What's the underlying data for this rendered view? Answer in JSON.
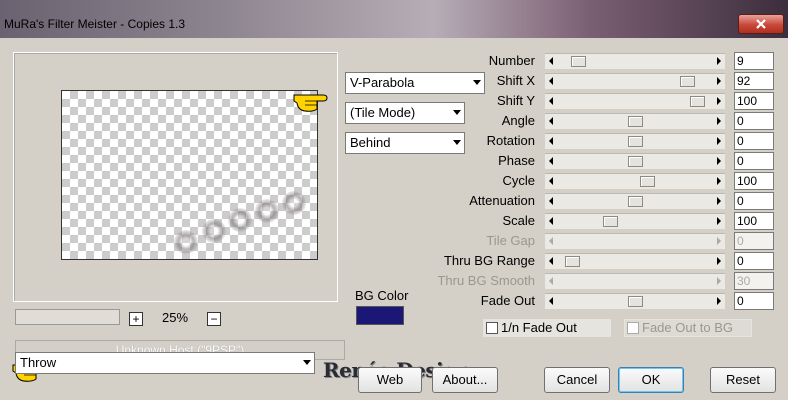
{
  "window": {
    "title": "MuRa's Filter Meister - Copies 1.3"
  },
  "preview": {
    "zoom": "25%",
    "zoom_in": "+",
    "zoom_out": "−",
    "host": "Unknown Host (\"9PSP\")"
  },
  "dropdowns": {
    "mode": "V-Parabola",
    "tile_mode": "(Tile Mode)",
    "placement": "Behind",
    "action": "Throw"
  },
  "bg_color": {
    "label": "BG Color",
    "value": "#1a1777"
  },
  "controls": [
    {
      "label": "Number",
      "value": "9",
      "level": 0.05,
      "enabled": true
    },
    {
      "label": "Shift X",
      "value": "92",
      "level": 0.92,
      "enabled": true
    },
    {
      "label": "Shift Y",
      "value": "100",
      "level": 1.0,
      "enabled": true
    },
    {
      "label": "Angle",
      "value": "0",
      "level": 0.5,
      "enabled": true
    },
    {
      "label": "Rotation",
      "value": "0",
      "level": 0.5,
      "enabled": true
    },
    {
      "label": "Phase",
      "value": "0",
      "level": 0.5,
      "enabled": true
    },
    {
      "label": "Cycle",
      "value": "100",
      "level": 0.6,
      "enabled": true
    },
    {
      "label": "Attenuation",
      "value": "0",
      "level": 0.5,
      "enabled": true
    },
    {
      "label": "Scale",
      "value": "100",
      "level": 0.3,
      "enabled": true
    },
    {
      "label": "Tile Gap",
      "value": "0",
      "level": 0.0,
      "enabled": false
    },
    {
      "label": "Thru BG Range",
      "value": "0",
      "level": 0.0,
      "enabled": true
    },
    {
      "label": "Thru BG Smooth",
      "value": "30",
      "level": 0.0,
      "enabled": false
    },
    {
      "label": "Fade Out",
      "value": "0",
      "level": 0.5,
      "enabled": true
    }
  ],
  "checkboxes": {
    "fade_out_1n": "1/n Fade Out",
    "fade_out_bg": "Fade Out to BG"
  },
  "logo": "Renée Design",
  "buttons": {
    "web": "Web",
    "about": "About...",
    "cancel": "Cancel",
    "ok": "OK",
    "reset": "Reset"
  },
  "colors": {
    "accent": "#3c7fb1",
    "swatch": "#1a1777"
  }
}
